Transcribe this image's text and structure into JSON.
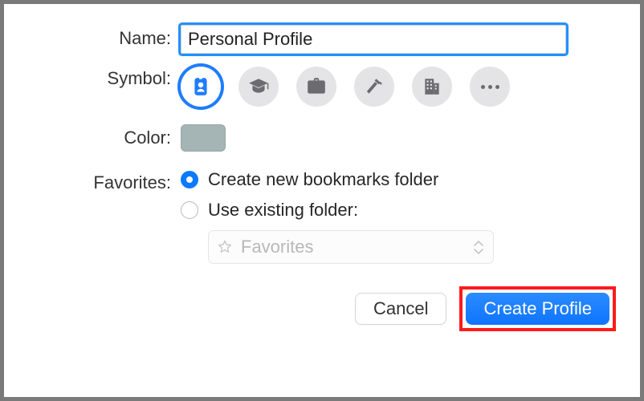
{
  "labels": {
    "name": "Name:",
    "symbol": "Symbol:",
    "color": "Color:",
    "favorites": "Favorites:"
  },
  "name": {
    "value": "Personal Profile"
  },
  "symbols": [
    {
      "id": "id-badge",
      "selected": true
    },
    {
      "id": "graduation-cap",
      "selected": false
    },
    {
      "id": "briefcase",
      "selected": false
    },
    {
      "id": "hammer",
      "selected": false
    },
    {
      "id": "building",
      "selected": false
    },
    {
      "id": "more",
      "selected": false
    }
  ],
  "color": {
    "hex": "#a5b5b5"
  },
  "favorites": {
    "option1": "Create new bookmarks folder",
    "option2": "Use existing folder:",
    "selected": "option1",
    "folder_placeholder": "Favorites"
  },
  "buttons": {
    "cancel": "Cancel",
    "create": "Create Profile"
  }
}
